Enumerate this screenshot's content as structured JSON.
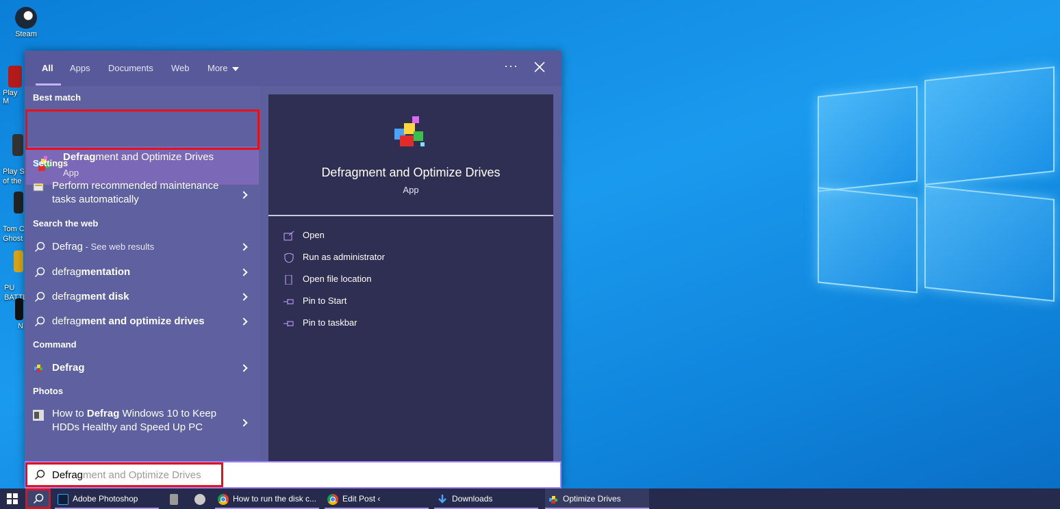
{
  "desktop": {
    "icons": [
      {
        "label": "Steam"
      },
      {
        "label": "Play M"
      },
      {
        "label": "Play S\nof the"
      },
      {
        "label": "Tom C\nGhost"
      },
      {
        "label": "PU\nBATTL"
      },
      {
        "label": "N"
      }
    ]
  },
  "search_panel": {
    "tabs": [
      "All",
      "Apps",
      "Documents",
      "Web",
      "More"
    ],
    "menu_dots": "···",
    "sections": {
      "best_match": "Best match",
      "settings": "Settings",
      "search_web": "Search the web",
      "command": "Command",
      "photos": "Photos"
    },
    "best_match": {
      "title_bold": "Defrag",
      "title_rest": "ment and Optimize Drives",
      "subtitle": "App"
    },
    "settings_item": {
      "line1": "Perform recommended maintenance",
      "line2": "tasks automatically"
    },
    "web_results": [
      {
        "plain": "Defrag",
        "bold": "",
        "suffix": " - See web results"
      },
      {
        "plain": "defrag",
        "bold": "mentation",
        "suffix": ""
      },
      {
        "plain": "defrag",
        "bold": "ment disk",
        "suffix": ""
      },
      {
        "plain": "defrag",
        "bold": "ment and optimize drives",
        "suffix": ""
      }
    ],
    "command_item": "Defrag",
    "photo_item": {
      "line1_pre": "How to ",
      "line1_bold": "Defrag",
      "line1_post": " Windows 10 to Keep",
      "line2": "HDDs Healthy and Speed Up PC"
    },
    "preview": {
      "title": "Defragment and Optimize Drives",
      "subtitle": "App",
      "actions": [
        "Open",
        "Run as administrator",
        "Open file location",
        "Pin to Start",
        "Pin to taskbar"
      ]
    },
    "search_input": {
      "typed": "Defrag",
      "autocomplete": "ment and Optimize Drives"
    }
  },
  "taskbar": {
    "items": [
      {
        "label": "Adobe Photoshop CC..."
      },
      {
        "label": "How to run the disk c..."
      },
      {
        "label": "Edit Post ‹ AddictiveTi..."
      },
      {
        "label": "Downloads"
      },
      {
        "label": "Optimize Drives"
      }
    ]
  },
  "colors": {
    "accent": "#a082ff",
    "highlight_box": "#e4101a",
    "panel": "#5d5f9c",
    "preview_bg": "#2f2f53",
    "taskbar": "#262b4d"
  }
}
